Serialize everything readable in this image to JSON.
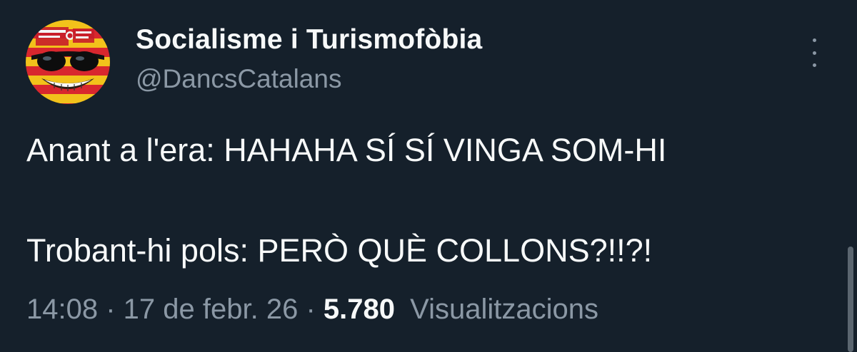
{
  "author": {
    "display_name": "Socialisme i Turismofòbia",
    "handle": "@DancsCatalans"
  },
  "avatar": {
    "icon": "smiley-sunglasses-avatar",
    "stripe_colors": [
      "#f2c21b",
      "#d8272e"
    ]
  },
  "tweet": {
    "line1": "Anant a l'era: HAHAHA SÍ SÍ VINGA SOM-HI",
    "line2": "Trobant-hi pols: PERÒ QUÈ COLLONS?!!?!"
  },
  "meta": {
    "time": "14:08",
    "separator": "·",
    "date": "17 de febr. 26",
    "views_count": "5.780",
    "views_label": "Visualitzacions"
  },
  "menu": {
    "icon": "more-vertical-icon"
  },
  "colors": {
    "background": "#15202b",
    "primary_text": "#f7f9f9",
    "secondary_text": "#8b98a5"
  }
}
